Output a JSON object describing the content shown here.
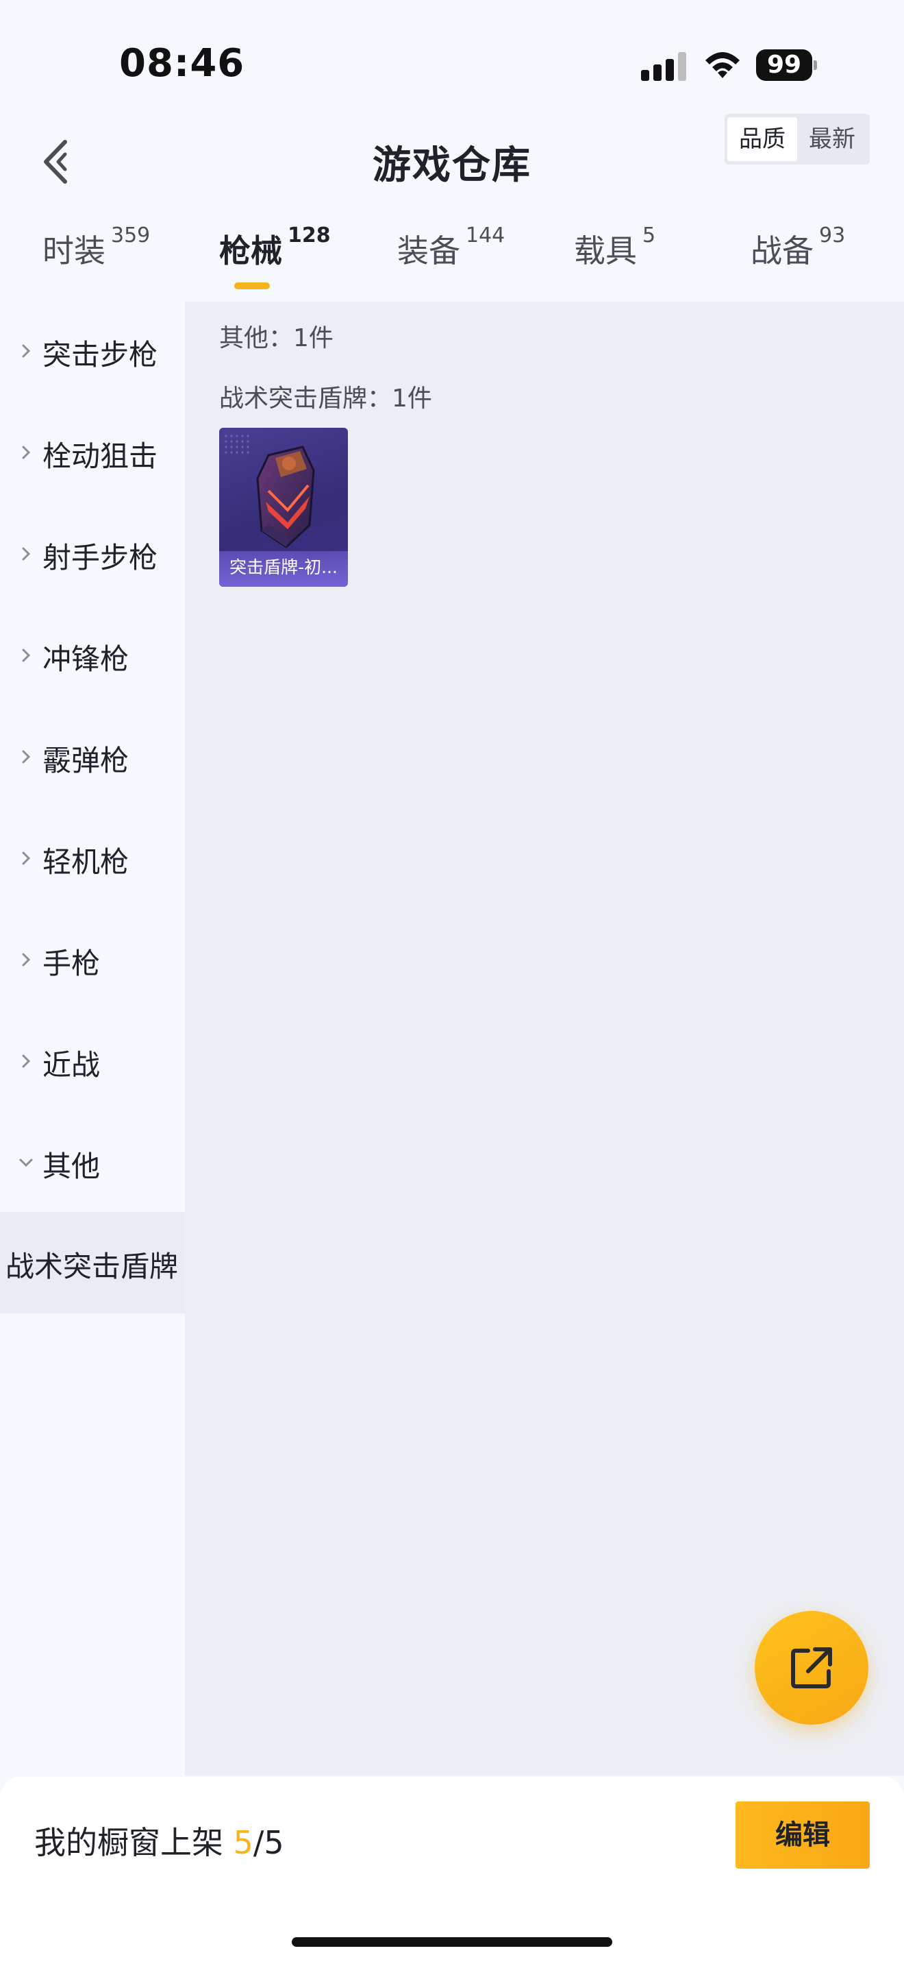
{
  "status_bar": {
    "time": "08:46",
    "battery": "99"
  },
  "header": {
    "title": "游戏仓库",
    "sort_options": [
      "品质",
      "最新"
    ],
    "active_sort": "品质"
  },
  "tabs": [
    {
      "label": "时装",
      "count": "359"
    },
    {
      "label": "枪械",
      "count": "128",
      "active": true
    },
    {
      "label": "装备",
      "count": "144"
    },
    {
      "label": "载具",
      "count": "5"
    },
    {
      "label": "战备",
      "count": "93"
    }
  ],
  "sidebar": {
    "categories": [
      "突击步枪",
      "栓动狙击",
      "射手步枪",
      "冲锋枪",
      "霰弹枪",
      "轻机枪",
      "手枪",
      "近战",
      "其他"
    ],
    "expanded": "其他",
    "subcategory": "战术突击盾牌"
  },
  "content": {
    "group_label": "其他：1件",
    "sub_label": "战术突击盾牌：1件",
    "items": [
      {
        "name": "突击盾牌-初..."
      }
    ]
  },
  "bottom_bar": {
    "prefix": "我的橱窗上架 ",
    "current": "5",
    "total": "/5",
    "edit_label": "编辑"
  },
  "colors": {
    "accent": "#f6b41f",
    "item_bg": "#3c3187"
  },
  "icons": {
    "back": "back-arrow-icon",
    "share": "share-external-icon",
    "expand": "chevron-icon"
  }
}
